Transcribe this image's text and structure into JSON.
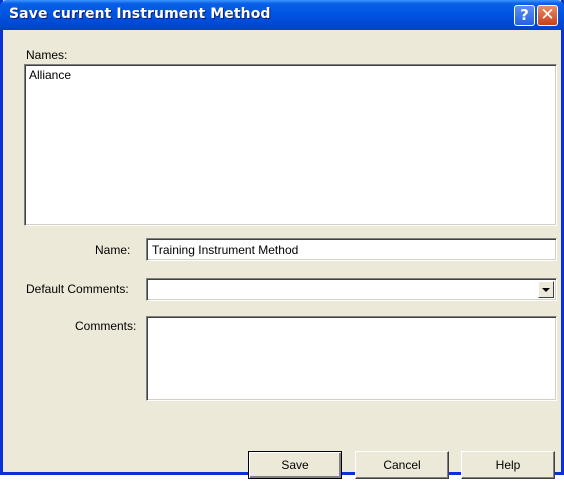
{
  "window": {
    "title": "Save current Instrument Method",
    "help_glyph": "?",
    "close_glyph": "✕"
  },
  "names": {
    "label": "Names:",
    "items": [
      "Alliance"
    ]
  },
  "name": {
    "label": "Name:",
    "value": "Training Instrument Method"
  },
  "default_comments": {
    "label": "Default Comments:",
    "value": ""
  },
  "comments": {
    "label": "Comments:",
    "value": ""
  },
  "buttons": {
    "save": "Save",
    "cancel": "Cancel",
    "help": "Help"
  },
  "colors": {
    "titlebar": "#0054e3",
    "dialog_face": "#ece9d8",
    "close_button": "#c8401a"
  },
  "icons": {
    "help": "help-icon",
    "close": "close-icon",
    "dropdown": "chevron-down-icon"
  }
}
